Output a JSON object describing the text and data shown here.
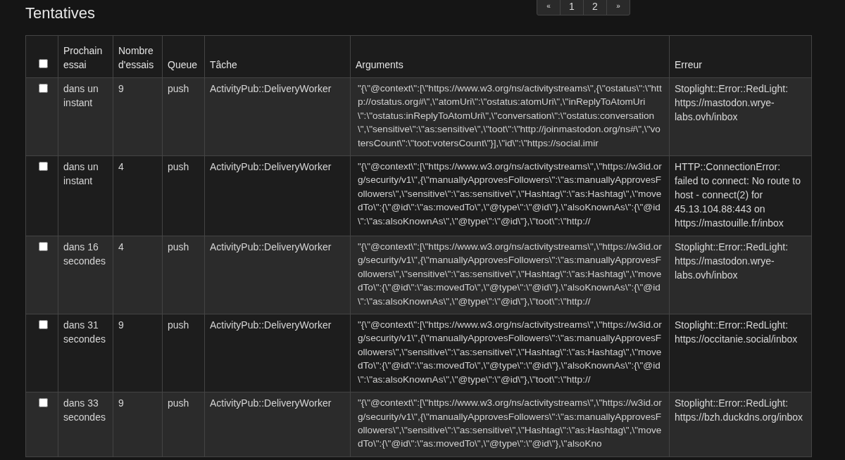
{
  "title": "Tentatives",
  "pagination": [
    "«",
    "1",
    "2",
    "»"
  ],
  "table": {
    "select_all": {
      "checked": false
    },
    "columns": [
      "Prochain essai",
      "Nombre d'essais",
      "Queue",
      "Tâche",
      "Arguments",
      "Erreur"
    ],
    "rows": [
      {
        "checked": false,
        "next_try": "dans un instant",
        "attempts": "9",
        "queue": "push",
        "task": "ActivityPub::DeliveryWorker",
        "arguments": "\"{\\\"@context\\\":[\\\"https://www.w3.org/ns/activitystreams\\\",{\\\"ostatus\\\":\\\"http://ostatus.org#\\\",\\\"atomUri\\\":\\\"ostatus:atomUri\\\",\\\"inReplyToAtomUri\\\":\\\"ostatus:inReplyToAtomUri\\\",\\\"conversation\\\":\\\"ostatus:conversation\\\",\\\"sensitive\\\":\\\"as:sensitive\\\",\\\"toot\\\":\\\"http://joinmastodon.org/ns#\\\",\\\"votersCount\\\":\\\"toot:votersCount\\\"}],\\\"id\\\":\\\"https://social.imir",
        "error": "Stoplight::Error::RedLight: https://mastodon.wrye-labs.ovh/inbox"
      },
      {
        "checked": false,
        "next_try": "dans un instant",
        "attempts": "4",
        "queue": "push",
        "task": "ActivityPub::DeliveryWorker",
        "arguments": "\"{\\\"@context\\\":[\\\"https://www.w3.org/ns/activitystreams\\\",\\\"https://w3id.org/security/v1\\\",{\\\"manuallyApprovesFollowers\\\":\\\"as:manuallyApprovesFollowers\\\",\\\"sensitive\\\":\\\"as:sensitive\\\",\\\"Hashtag\\\":\\\"as:Hashtag\\\",\\\"movedTo\\\":{\\\"@id\\\":\\\"as:movedTo\\\",\\\"@type\\\":\\\"@id\\\"},\\\"alsoKnownAs\\\":{\\\"@id\\\":\\\"as:alsoKnownAs\\\",\\\"@type\\\":\\\"@id\\\"},\\\"toot\\\":\\\"http://",
        "error": "HTTP::ConnectionError: failed to connect: No route to host - connect(2) for 45.13.104.88:443 on https://mastouille.fr/inbox"
      },
      {
        "checked": false,
        "next_try": "dans 16 secondes",
        "attempts": "4",
        "queue": "push",
        "task": "ActivityPub::DeliveryWorker",
        "arguments": "\"{\\\"@context\\\":[\\\"https://www.w3.org/ns/activitystreams\\\",\\\"https://w3id.org/security/v1\\\",{\\\"manuallyApprovesFollowers\\\":\\\"as:manuallyApprovesFollowers\\\",\\\"sensitive\\\":\\\"as:sensitive\\\",\\\"Hashtag\\\":\\\"as:Hashtag\\\",\\\"movedTo\\\":{\\\"@id\\\":\\\"as:movedTo\\\",\\\"@type\\\":\\\"@id\\\"},\\\"alsoKnownAs\\\":{\\\"@id\\\":\\\"as:alsoKnownAs\\\",\\\"@type\\\":\\\"@id\\\"},\\\"toot\\\":\\\"http://",
        "error": "Stoplight::Error::RedLight: https://mastodon.wrye-labs.ovh/inbox"
      },
      {
        "checked": false,
        "next_try": "dans 31 secondes",
        "attempts": "9",
        "queue": "push",
        "task": "ActivityPub::DeliveryWorker",
        "arguments": "\"{\\\"@context\\\":[\\\"https://www.w3.org/ns/activitystreams\\\",\\\"https://w3id.org/security/v1\\\",{\\\"manuallyApprovesFollowers\\\":\\\"as:manuallyApprovesFollowers\\\",\\\"sensitive\\\":\\\"as:sensitive\\\",\\\"Hashtag\\\":\\\"as:Hashtag\\\",\\\"movedTo\\\":{\\\"@id\\\":\\\"as:movedTo\\\",\\\"@type\\\":\\\"@id\\\"},\\\"alsoKnownAs\\\":{\\\"@id\\\":\\\"as:alsoKnownAs\\\",\\\"@type\\\":\\\"@id\\\"},\\\"toot\\\":\\\"http://",
        "error": "Stoplight::Error::RedLight: https://occitanie.social/inbox"
      },
      {
        "checked": false,
        "next_try": "dans 33 secondes",
        "attempts": "9",
        "queue": "push",
        "task": "ActivityPub::DeliveryWorker",
        "arguments": "\"{\\\"@context\\\":[\\\"https://www.w3.org/ns/activitystreams\\\",\\\"https://w3id.org/security/v1\\\",{\\\"manuallyApprovesFollowers\\\":\\\"as:manuallyApprovesFollowers\\\",\\\"sensitive\\\":\\\"as:sensitive\\\",\\\"Hashtag\\\":\\\"as:Hashtag\\\",\\\"movedTo\\\":{\\\"@id\\\":\\\"as:movedTo\\\",\\\"@type\\\":\\\"@id\\\"},\\\"alsoKno",
        "error": "Stoplight::Error::RedLight: https://bzh.duckdns.org/inbox"
      }
    ]
  }
}
